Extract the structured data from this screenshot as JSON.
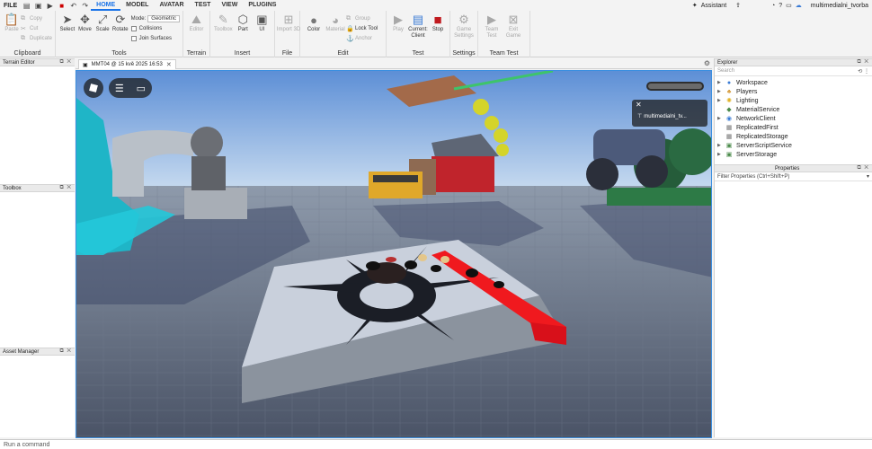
{
  "menubar": {
    "file": "FILE",
    "tabs": [
      "HOME",
      "MODEL",
      "AVATAR",
      "TEST",
      "VIEW",
      "PLUGINS"
    ],
    "assistant": "Assistant",
    "user": "multimedialni_tvorba"
  },
  "ribbon": {
    "clipboard": {
      "label": "Clipboard",
      "paste": "Paste",
      "copy": "Copy",
      "cut": "Cut",
      "duplicate": "Duplicate"
    },
    "tools": {
      "label": "Tools",
      "select": "Select",
      "move": "Move",
      "scale": "Scale",
      "rotate": "Rotate",
      "mode_label": "Mode:",
      "mode_value": "Geometric",
      "collisions": "Collisions",
      "join_surfaces": "Join Surfaces"
    },
    "terrain": {
      "label": "Terrain",
      "editor": "Editor"
    },
    "insert": {
      "label": "Insert",
      "toolbox": "Toolbox",
      "part": "Part",
      "ui": "UI"
    },
    "file": {
      "label": "File",
      "import3d": "Import 3D"
    },
    "edit": {
      "label": "Edit",
      "color": "Color",
      "material": "Material",
      "group": "Group",
      "lock_tool": "Lock Tool",
      "anchor": "Anchor"
    },
    "test": {
      "label": "Test",
      "play": "Play",
      "current_client": "Current: Client",
      "stop": "Stop"
    },
    "settings": {
      "label": "Settings",
      "game_settings": "Game Settings"
    },
    "team_test": {
      "label": "Team Test",
      "team_test": "Team Test",
      "exit_game": "Exit Game"
    }
  },
  "left_panels": {
    "terrain_editor": "Terrain Editor",
    "toolbox": "Toolbox",
    "asset_manager": "Asset Manager"
  },
  "document": {
    "tab_title": "MMT04 @ 15 kvě 2025 16:53",
    "player_name": "multimedialni_tv..."
  },
  "explorer": {
    "title": "Explorer",
    "search_placeholder": "Search",
    "items": [
      {
        "name": "Workspace",
        "icon": "globe-icon",
        "color": "#3a7bd5"
      },
      {
        "name": "Players",
        "icon": "players-icon",
        "color": "#d59a3a"
      },
      {
        "name": "Lighting",
        "icon": "lightbulb-icon",
        "color": "#e0b020"
      },
      {
        "name": "MaterialService",
        "icon": "material-icon",
        "color": "#4a8a4a"
      },
      {
        "name": "NetworkClient",
        "icon": "network-icon",
        "color": "#3a7bd5"
      },
      {
        "name": "ReplicatedFirst",
        "icon": "replicated-first-icon",
        "color": "#777777"
      },
      {
        "name": "ReplicatedStorage",
        "icon": "replicated-storage-icon",
        "color": "#777777"
      },
      {
        "name": "ServerScriptService",
        "icon": "server-script-icon",
        "color": "#4a8a4a"
      },
      {
        "name": "ServerStorage",
        "icon": "server-storage-icon",
        "color": "#4a8a4a"
      }
    ]
  },
  "properties": {
    "title": "Properties",
    "filter": "Filter Properties (Ctrl+Shift+P)"
  },
  "command_bar": {
    "placeholder": "Run a command"
  }
}
